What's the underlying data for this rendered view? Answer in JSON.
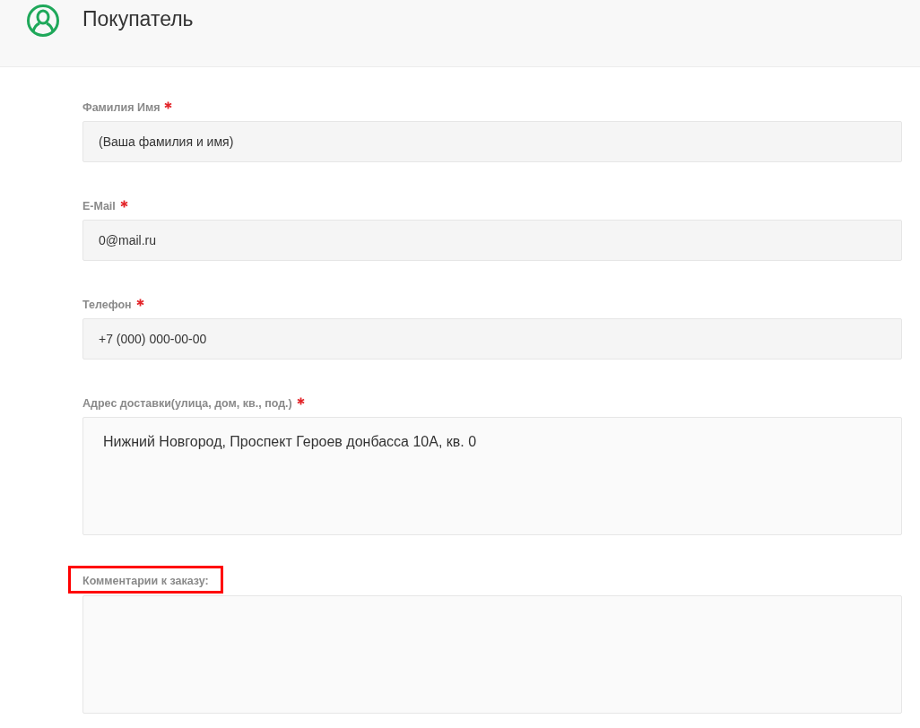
{
  "header": {
    "title": "Покупатель"
  },
  "fields": [
    {
      "kind": "input",
      "label": "Фамилия Имя",
      "required": true,
      "highlighted": false,
      "value": "(Ваша фамилия и имя)"
    },
    {
      "kind": "input",
      "label": "E-Mail",
      "required": true,
      "highlighted": false,
      "value": "0@mail.ru"
    },
    {
      "kind": "input",
      "label": "Телефон",
      "required": true,
      "highlighted": false,
      "value": "+7 (000) 000-00-00"
    },
    {
      "kind": "textarea",
      "label": "Адрес доставки(улица, дом, кв., под.)",
      "required": true,
      "highlighted": false,
      "value": "Нижний Новгород, Проспект Героев донбасса 10А, кв. 0"
    },
    {
      "kind": "textarea",
      "label": "Комментарии к заказу:",
      "required": false,
      "highlighted": true
    }
  ]
}
